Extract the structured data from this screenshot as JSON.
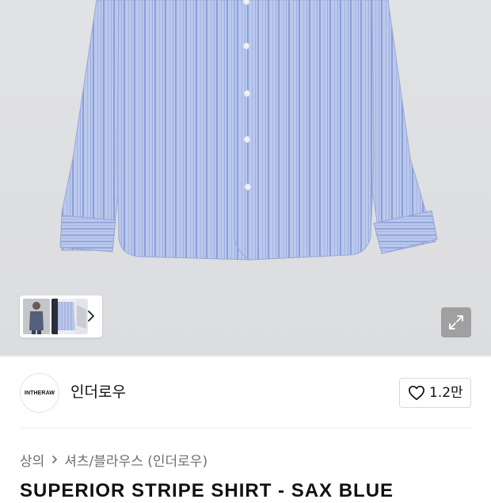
{
  "gallery": {
    "thumbnails": [
      "model-front",
      "product-flat",
      "product-detail"
    ],
    "next_icon": "chevron-right-icon",
    "expand_icon": "expand-arrows-icon"
  },
  "brand": {
    "logo_text": "INTHERAW",
    "name": "인더로우",
    "like_icon": "heart-outline-icon",
    "like_count": "1.2만"
  },
  "breadcrumb": {
    "items": [
      "상의",
      "셔츠/블라우스 (인더로우)"
    ],
    "separator_icon": "chevron-right-icon"
  },
  "product": {
    "title": "SUPERIOR STRIPE SHIRT - SAX BLUE"
  },
  "colors": {
    "shirt_base": "#b7c6ea",
    "stripe": "#8ea3da",
    "background": "#dfe0e2"
  }
}
